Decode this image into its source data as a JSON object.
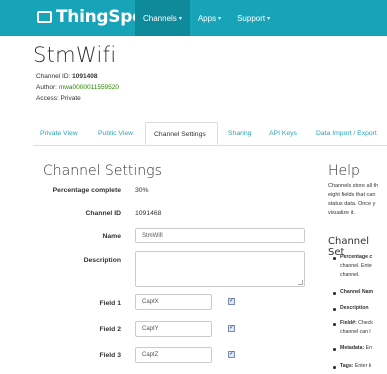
{
  "brand": {
    "name": "ThingSpeak",
    "tm": "™"
  },
  "nav": [
    {
      "label": "Channels",
      "dropdown": true,
      "active": true
    },
    {
      "label": "Apps",
      "dropdown": true
    },
    {
      "label": "Support",
      "dropdown": true
    }
  ],
  "channel": {
    "name": "StmWifi",
    "id_label": "Channel ID:",
    "id_value": "1091408",
    "author_label": "Author:",
    "author_value": "mwa0000011559520",
    "access": "Access: Private"
  },
  "tabs": [
    {
      "label": "Private View"
    },
    {
      "label": "Public View"
    },
    {
      "label": "Channel Settings",
      "active": true
    },
    {
      "label": "Sharing"
    },
    {
      "label": "API Keys"
    },
    {
      "label": "Data Import / Export"
    }
  ],
  "settings": {
    "heading": "Channel Settings",
    "percent_label": "Percentage complete",
    "percent_value": "30%",
    "channel_id_label": "Channel ID",
    "channel_id_value": "1091468",
    "name_label": "Name",
    "name_value": "StmWifi",
    "description_label": "Description",
    "description_value": "",
    "fields": [
      {
        "label": "Field 1",
        "value": "CaptX",
        "checked": true
      },
      {
        "label": "Field 2",
        "value": "CaptY",
        "checked": true
      },
      {
        "label": "Field 3",
        "value": "CaptZ",
        "checked": true
      }
    ]
  },
  "help": {
    "heading": "Help",
    "lines": [
      "Channels store all th",
      "eight fields that can",
      "status data. Once y",
      "visualize it."
    ],
    "subheading": "Channel Set",
    "bullets": [
      {
        "term": "Percentage c",
        "rest_lines": [
          "channel. Ente",
          "channel."
        ]
      },
      {
        "term": "Channel Nam",
        "rest_lines": []
      },
      {
        "term": "Description",
        "rest_lines": []
      },
      {
        "term": "Field#:",
        "rest": " Check",
        "rest_lines": [
          "channel can l"
        ]
      },
      {
        "term": "Metadata:",
        "rest": " En",
        "rest_lines": []
      },
      {
        "term": "Tags:",
        "rest": " Enter k",
        "rest_lines": []
      }
    ]
  }
}
